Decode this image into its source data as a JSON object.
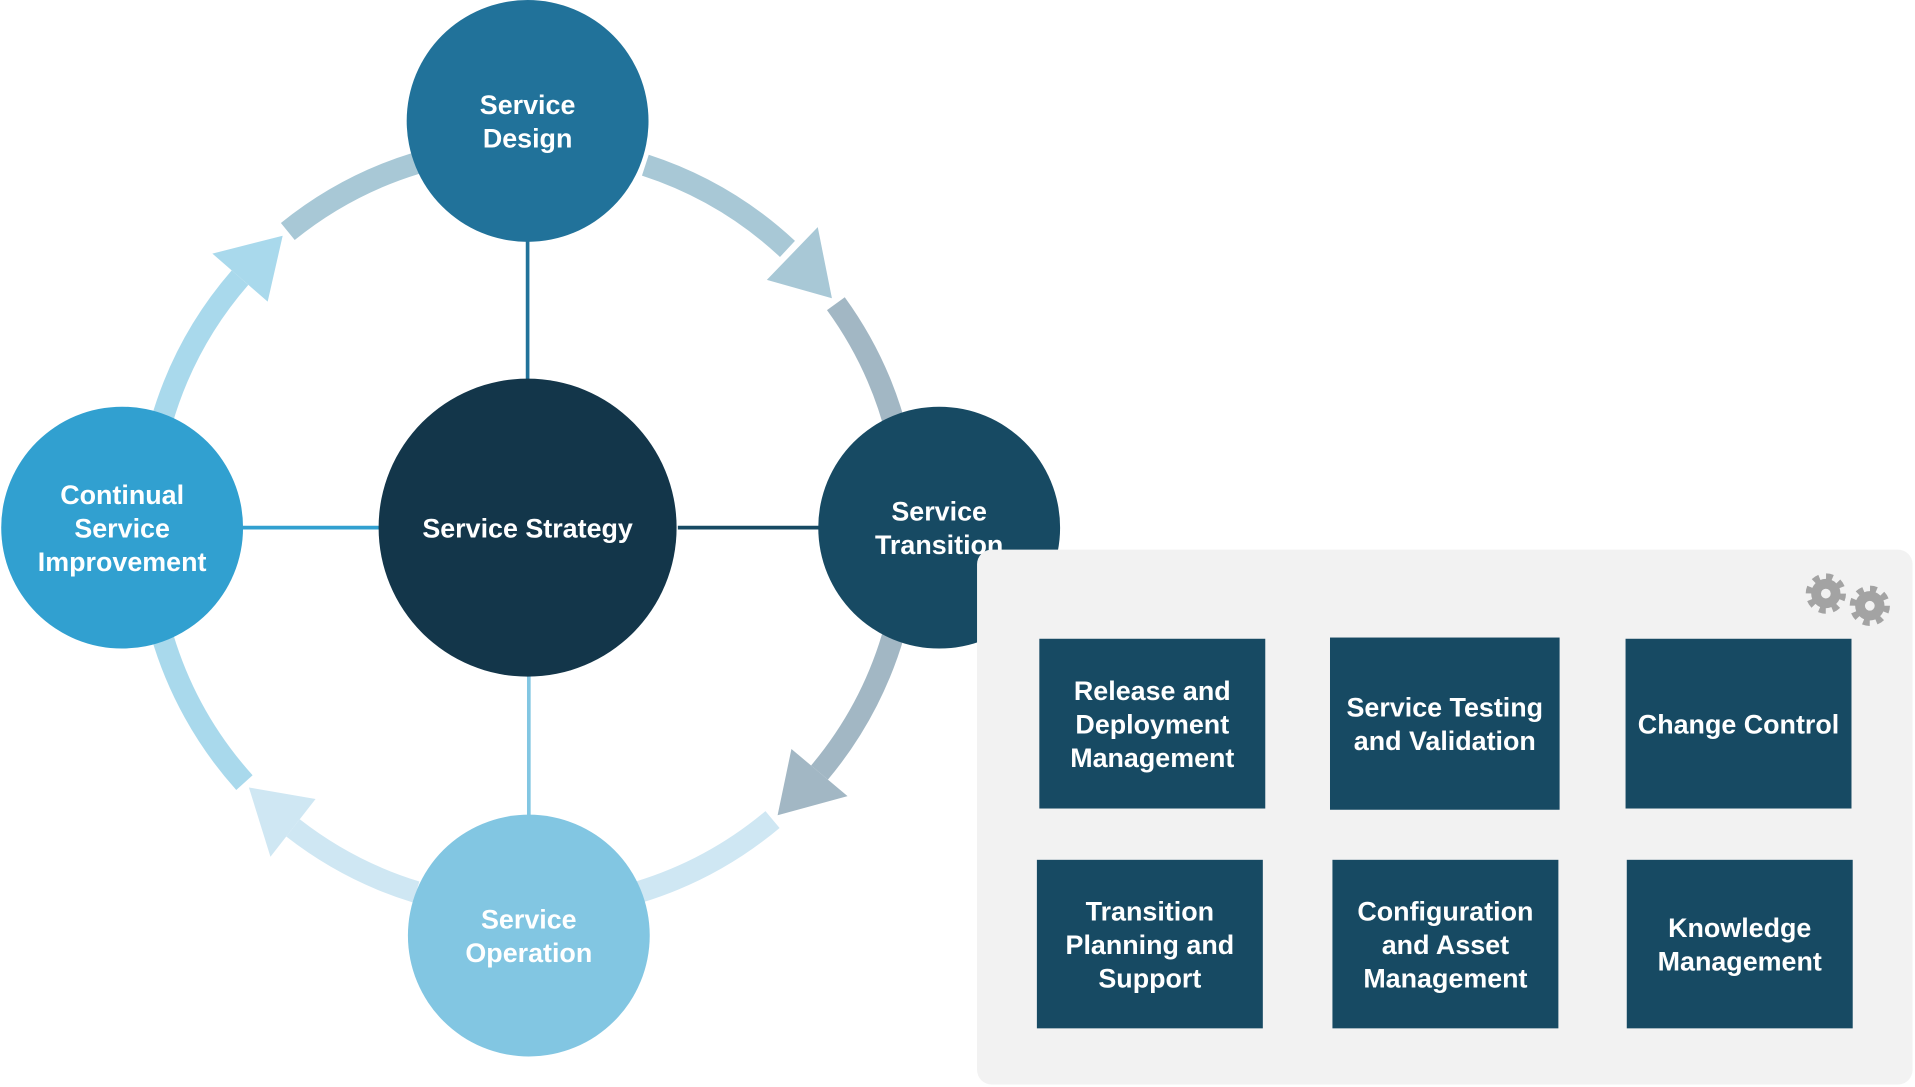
{
  "colors": {
    "service_design": "#21729a",
    "service_strategy": "#13364a",
    "service_transition": "#174a63",
    "continual_service_improvement": "#31a0d0",
    "service_operation": "#82c6e2",
    "process_box": "#174a63",
    "panel": "#f2f2f2",
    "gear": "#a3a3a3"
  },
  "lifecycle": {
    "center": {
      "lines": [
        "Service Strategy"
      ]
    },
    "stages": [
      {
        "id": "design",
        "lines": [
          "Service",
          "Design"
        ]
      },
      {
        "id": "transition",
        "lines": [
          "Service",
          "Transition"
        ]
      },
      {
        "id": "operation",
        "lines": [
          "Service",
          "Operation"
        ]
      },
      {
        "id": "csi",
        "lines": [
          "Continual",
          "Service",
          "Improvement"
        ]
      }
    ]
  },
  "panel": {
    "icon": "gears-icon",
    "processes": [
      {
        "lines": [
          "Release and",
          "Deployment",
          "Management"
        ]
      },
      {
        "lines": [
          "Service Testing",
          "and Validation"
        ]
      },
      {
        "lines": [
          "Change Control"
        ]
      },
      {
        "lines": [
          "Transition",
          "Planning and",
          "Support"
        ]
      },
      {
        "lines": [
          "Configuration",
          "and Asset",
          "Management"
        ]
      },
      {
        "lines": [
          "Knowledge",
          "Management"
        ]
      }
    ]
  }
}
